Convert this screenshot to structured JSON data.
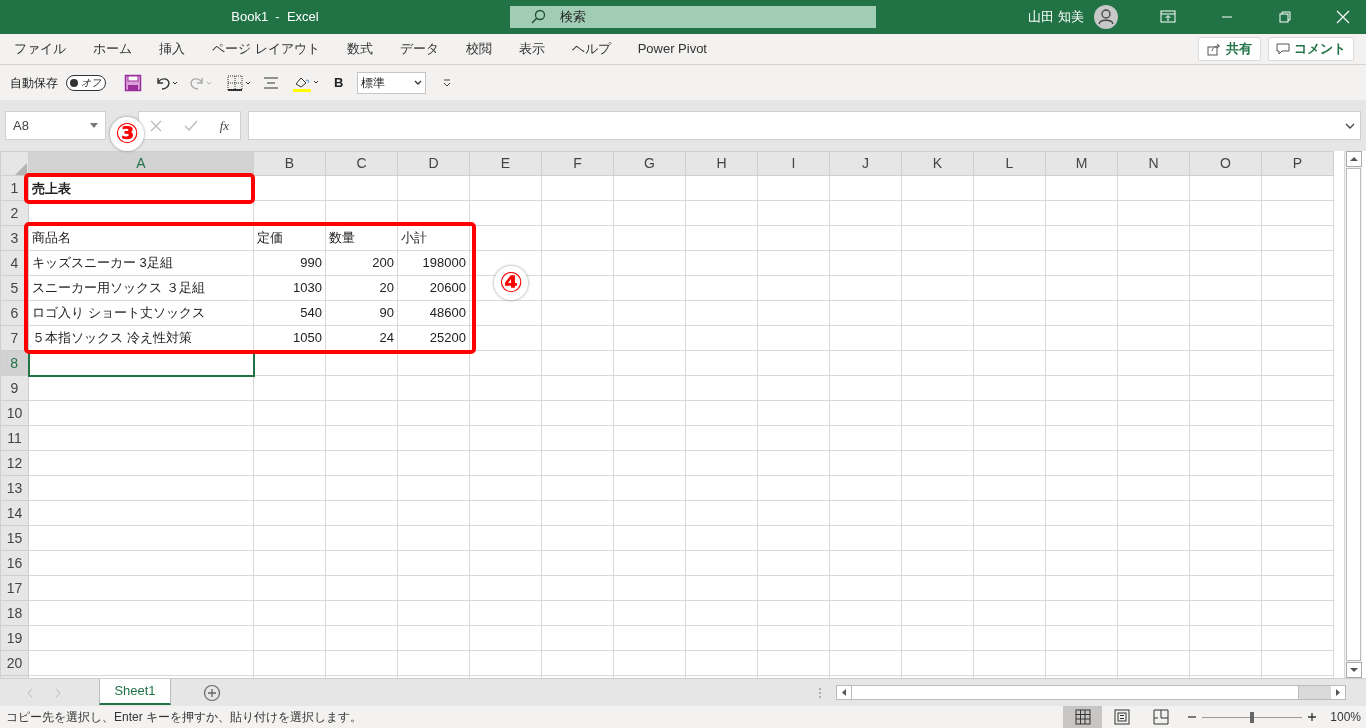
{
  "window": {
    "title": "Book1  -  Excel",
    "search_placeholder": "検索",
    "user": "山田 知美"
  },
  "ribbon_tabs": [
    {
      "label": "ファイル",
      "selected": false
    },
    {
      "label": "ホーム",
      "selected": false
    },
    {
      "label": "挿入",
      "selected": false
    },
    {
      "label": "ページ レイアウト",
      "selected": false
    },
    {
      "label": "数式",
      "selected": false
    },
    {
      "label": "データ",
      "selected": false
    },
    {
      "label": "校閲",
      "selected": false
    },
    {
      "label": "表示",
      "selected": false
    },
    {
      "label": "ヘルプ",
      "selected": false
    },
    {
      "label": "Power Pivot",
      "selected": false
    }
  ],
  "share_button": "共有",
  "comment_button": "コメント",
  "quick_access": {
    "autosave_label": "自動保存",
    "autosave_on": false,
    "autosave_state": "オフ",
    "bold": "B",
    "number_format": "標準"
  },
  "formula_bar": {
    "name_box": "A8",
    "function_label": "fx"
  },
  "columns": [
    {
      "label": "A",
      "selected": true
    },
    {
      "label": "B",
      "selected": false
    },
    {
      "label": "C",
      "selected": false
    },
    {
      "label": "D",
      "selected": false
    },
    {
      "label": "E",
      "selected": false
    },
    {
      "label": "F",
      "selected": false
    },
    {
      "label": "G",
      "selected": false
    },
    {
      "label": "H",
      "selected": false
    },
    {
      "label": "I",
      "selected": false
    },
    {
      "label": "J",
      "selected": false
    },
    {
      "label": "K",
      "selected": false
    },
    {
      "label": "L",
      "selected": false
    },
    {
      "label": "M",
      "selected": false
    },
    {
      "label": "N",
      "selected": false
    },
    {
      "label": "O",
      "selected": false
    },
    {
      "label": "P",
      "selected": false
    }
  ],
  "rows": [
    {
      "number": "1",
      "selected": false,
      "kind": "title",
      "cells": [
        "売上表"
      ]
    },
    {
      "number": "2",
      "selected": false,
      "kind": "empty"
    },
    {
      "number": "3",
      "selected": false,
      "kind": "header",
      "cells": [
        "商品名",
        "定価",
        "数量",
        "小計"
      ]
    },
    {
      "number": "4",
      "selected": false,
      "kind": "data",
      "cells": [
        "キッズスニーカー 3足組",
        "990",
        "200",
        "198000"
      ]
    },
    {
      "number": "5",
      "selected": false,
      "kind": "data",
      "cells": [
        "スニーカー用ソックス ３足組",
        "1030",
        "20",
        "20600"
      ]
    },
    {
      "number": "6",
      "selected": false,
      "kind": "data",
      "cells": [
        "ロゴ入り ショート丈ソックス",
        "540",
        "90",
        "48600"
      ]
    },
    {
      "number": "7",
      "selected": false,
      "kind": "data",
      "cells": [
        "５本指ソックス 冷え性対策",
        "1050",
        "24",
        "25200"
      ]
    },
    {
      "number": "8",
      "selected": true,
      "kind": "empty"
    },
    {
      "number": "9",
      "selected": false,
      "kind": "empty"
    },
    {
      "number": "10",
      "selected": false,
      "kind": "empty"
    },
    {
      "number": "11",
      "selected": false,
      "kind": "empty"
    },
    {
      "number": "12",
      "selected": false,
      "kind": "empty"
    },
    {
      "number": "13",
      "selected": false,
      "kind": "empty"
    },
    {
      "number": "14",
      "selected": false,
      "kind": "empty"
    },
    {
      "number": "15",
      "selected": false,
      "kind": "empty"
    },
    {
      "number": "16",
      "selected": false,
      "kind": "empty"
    },
    {
      "number": "17",
      "selected": false,
      "kind": "empty"
    },
    {
      "number": "18",
      "selected": false,
      "kind": "empty"
    },
    {
      "number": "19",
      "selected": false,
      "kind": "empty"
    },
    {
      "number": "20",
      "selected": false,
      "kind": "empty"
    }
  ],
  "annotations": [
    {
      "label": "③"
    },
    {
      "label": "④"
    }
  ],
  "sheet_tabs": [
    {
      "label": "Sheet1",
      "selected": true
    }
  ],
  "status_bar": {
    "message": "コピー先を選択し、Enter キーを押すか、貼り付けを選択します。",
    "views": [
      {
        "kind": "normal",
        "selected": true
      },
      {
        "kind": "page_layout",
        "selected": false
      },
      {
        "kind": "page_break",
        "selected": false
      }
    ],
    "zoom": {
      "level": 0.5,
      "label": "100%"
    }
  }
}
